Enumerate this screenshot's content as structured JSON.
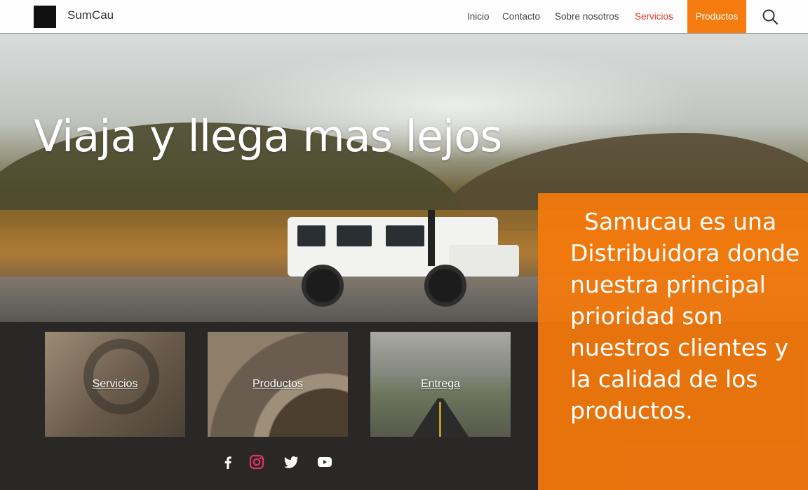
{
  "navbar": {
    "brand": "SumCau",
    "items": [
      {
        "label": "Inicio",
        "active": false
      },
      {
        "label": "Contacto",
        "active": false
      },
      {
        "label": "Sobre nosotros",
        "active": false
      },
      {
        "label": "Servicios",
        "active": true
      },
      {
        "label": "Productos",
        "active": false
      }
    ],
    "search_icon": "search-icon"
  },
  "hero": {
    "title": "Viaja y llega mas lejos"
  },
  "about": {
    "text": "Samucau es una Distribuidora donde nuestra principal prioridad son nuestros clientes y la calidad de los productos."
  },
  "cards": [
    {
      "label": "Servicios"
    },
    {
      "label": "Productos"
    },
    {
      "label": "Entrega"
    }
  ],
  "social": [
    "facebook-icon",
    "instagram-icon",
    "twitter-icon",
    "youtube-icon"
  ],
  "colors": {
    "accent": "#f57d10",
    "active_link": "#e0382b",
    "instagram": "#e1306c"
  }
}
